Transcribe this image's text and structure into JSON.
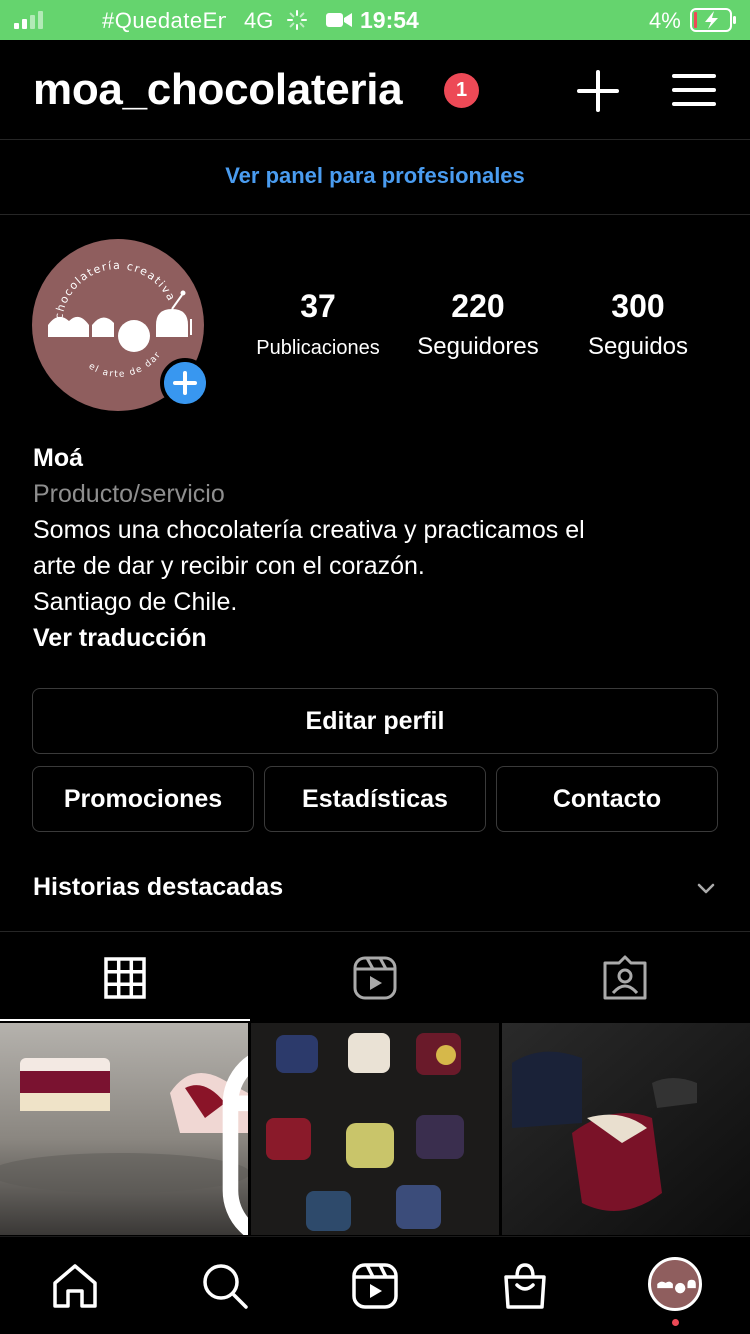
{
  "status_bar": {
    "carrier": "#QuedateEnCasa",
    "network": "4G",
    "time": "19:54",
    "battery": "4%",
    "bg_color": "#65d46e"
  },
  "header": {
    "username": "moa_chocolateria",
    "notification_count": "1",
    "add_icon": "plus-icon",
    "menu_icon": "hamburger-menu-icon"
  },
  "pro_panel": {
    "label": "Ver panel para profesionales",
    "color": "#4a9cf0"
  },
  "profile": {
    "avatar_text_top": "chocolatería creativa",
    "avatar_text_bottom": "el arte de dar",
    "stats": [
      {
        "value": "37",
        "label": "Publicaciones"
      },
      {
        "value": "220",
        "label": "Seguidores"
      },
      {
        "value": "300",
        "label": "Seguidos"
      }
    ],
    "name": "Moá",
    "category": "Producto/servicio",
    "bio_line1": "Somos una chocolatería creativa y practicamos el",
    "bio_line2": "arte de dar y recibir con el corazón.",
    "bio_line3": "Santiago de Chile.",
    "translate": "Ver traducción"
  },
  "buttons": {
    "edit": "Editar perfil",
    "promotions": "Promociones",
    "statistics": "Estadísticas",
    "contact": "Contacto"
  },
  "highlights": {
    "label": "Historias destacadas"
  },
  "tabs": [
    {
      "icon": "grid-icon",
      "active": true
    },
    {
      "icon": "reels-icon",
      "active": false
    },
    {
      "icon": "tagged-icon",
      "active": false
    }
  ],
  "bottom_nav": [
    "home-icon",
    "search-icon",
    "reels-icon",
    "shop-icon",
    "profile-avatar"
  ]
}
